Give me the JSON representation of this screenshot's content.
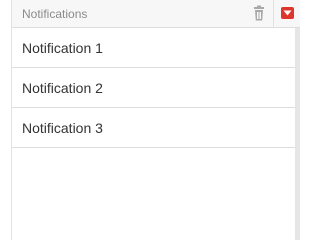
{
  "header": {
    "title": "Notifications",
    "trash_icon": "trash-icon",
    "dropdown_icon": "caret-down-icon",
    "accent_color": "#e0352b"
  },
  "notifications": [
    {
      "label": "Notification 1"
    },
    {
      "label": "Notification 2"
    },
    {
      "label": "Notification 3"
    }
  ]
}
